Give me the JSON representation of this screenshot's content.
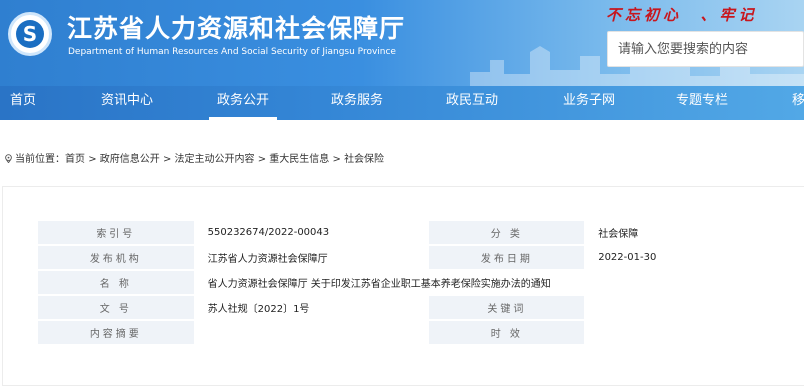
{
  "header": {
    "title_cn": "江苏省人力资源和社会保障厅",
    "title_en": "Department of Human Resources And Social Security of Jiangsu Province",
    "slogan": "不忘初心  、牢记",
    "logo_name": "jiangsu-hrss-logo",
    "logo_char": "S"
  },
  "search": {
    "placeholder": "请输入您要搜索的内容"
  },
  "nav": {
    "items": [
      "首页",
      "资讯中心",
      "政务公开",
      "政务服务",
      "政民互动",
      "业务子网",
      "专题专栏",
      "移"
    ],
    "active": "政务公开"
  },
  "breadcrumb": {
    "prefix": "当前位置：",
    "items": [
      "首页",
      "政府信息公开",
      "法定主动公开内容",
      "重大民生信息",
      "社会保险"
    ],
    "separator": ">"
  },
  "info": {
    "index_label": "索引号",
    "index_value": "550232674/2022-00043",
    "category_label": "分  类",
    "category_value": "社会保障",
    "publisher_label": "发布机构",
    "publisher_value": "江苏省人力资源社会保障厅",
    "date_label": "发布日期",
    "date_value": "2022-01-30",
    "name_label": "名  称",
    "name_value": "省人力资源社会保障厅 关于印发江苏省企业职工基本养老保险实施办法的通知",
    "doc_no_label": "文  号",
    "doc_no_value": "苏人社规〔2022〕1号",
    "keywords_label": "关键词",
    "keywords_value": "",
    "summary_label": "内容摘要",
    "summary_value": "",
    "validity_label": "时  效",
    "validity_value": ""
  },
  "colors": {
    "header_blue": "#2f7fd0",
    "slogan_red": "#c8161d",
    "label_bg": "#eff3f8"
  }
}
